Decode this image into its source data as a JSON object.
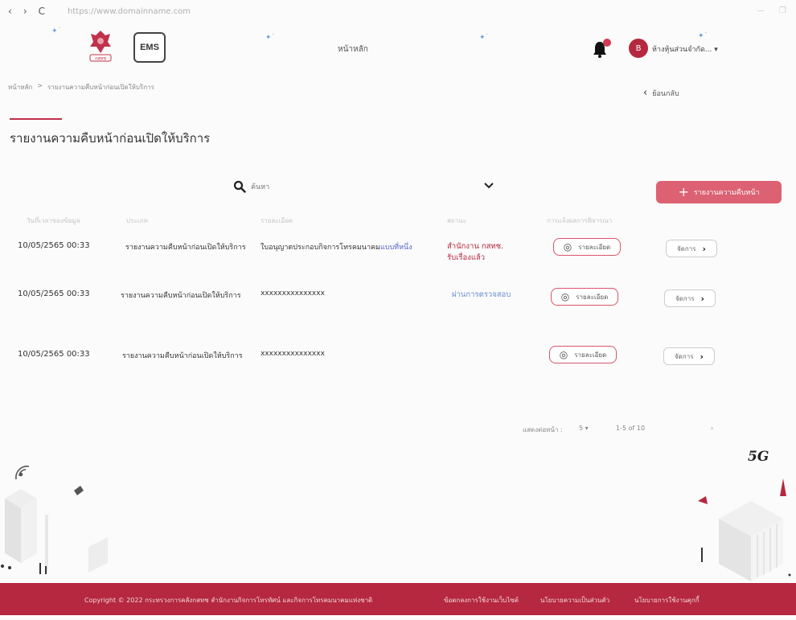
{
  "browser": {
    "back": "‹",
    "forward": "›",
    "reload": "C",
    "url": "https://www.domainname.com"
  },
  "header": {
    "home_label": "หน้าหลัก",
    "ems_label": "EMS",
    "police_label": "กสทช",
    "avatar_initial": "B",
    "user_name": "ห้างหุ้นส่วนจำกัด..."
  },
  "breadcrumb": {
    "home": "หน้าหลัก",
    "separator": ">",
    "current": "รายงานความคืบหน้าก่อนเปิดให้บริการ"
  },
  "back_label": "ย้อนกลับ",
  "page_title": "รายงานความคืบหน้าก่อนเปิดให้บริการ",
  "toolbar": {
    "search_placeholder": "ค้นหา",
    "add_button_label": "รายงานความคืบหน้า",
    "add_icon": "+"
  },
  "table": {
    "columns": [
      "วันที่เวลาของข้อมูล",
      "ประเภท",
      "รายละเอียด",
      "สถานะ",
      "การแจ้งผลการพิจารณา"
    ],
    "rows": [
      {
        "date": "10/05/2565  00:33",
        "type": "รายงานความคืบหน้าก่อนเปิดให้บริการ",
        "detail": "ใบอนุญาตประกอบกิจการโทรคมนาคม",
        "detail_link": "แบบที่หนึ่ง",
        "status_line1": "สำนักงาน กสทช.",
        "status_line2": "รับเรื่องแล้ว",
        "view_label": "รายละเอียด",
        "manage_label": "จัดการ"
      },
      {
        "date": "10/05/2565  00:33",
        "type": "รายงานความคืบหน้าก่อนเปิดให้บริการ",
        "detail": "xxxxxxxxxxxxxxx",
        "status_line1": "ผ่านการตรวจสอบ",
        "view_label": "รายละเอียด",
        "manage_label": "จัดการ"
      },
      {
        "date": "10/05/2565  00:33",
        "type": "รายงานความคืบหน้าก่อนเปิดให้บริการ",
        "detail": "xxxxxxxxxxxxxxx",
        "view_label": "รายละเอียด",
        "manage_label": "จัดการ"
      }
    ]
  },
  "pagination": {
    "rows_per_page_label": "แสดงต่อหน้า :",
    "rows_per_page": "5",
    "range": "1-5 of 10",
    "next": "›"
  },
  "decor": {
    "label_5g": "5G"
  },
  "footer": {
    "copyright": "Copyright © 2022 กระทรวงการคลังกสทช สำนักงานกิจการโทรทัศน์ และกิจการโทรคมนาคมแห่งชาติ",
    "link1": "ข้อตกลงการใช้งานเว็บไซต์",
    "link2": "นโยบายความเป็นส่วนตัว",
    "link3": "นโยบายการใช้งานคุกกี้"
  },
  "colors": {
    "brand": "#b5283f",
    "add_button": "#dc6172",
    "status_pending": "#b5283f",
    "status_passed": "#6a8fd0"
  }
}
